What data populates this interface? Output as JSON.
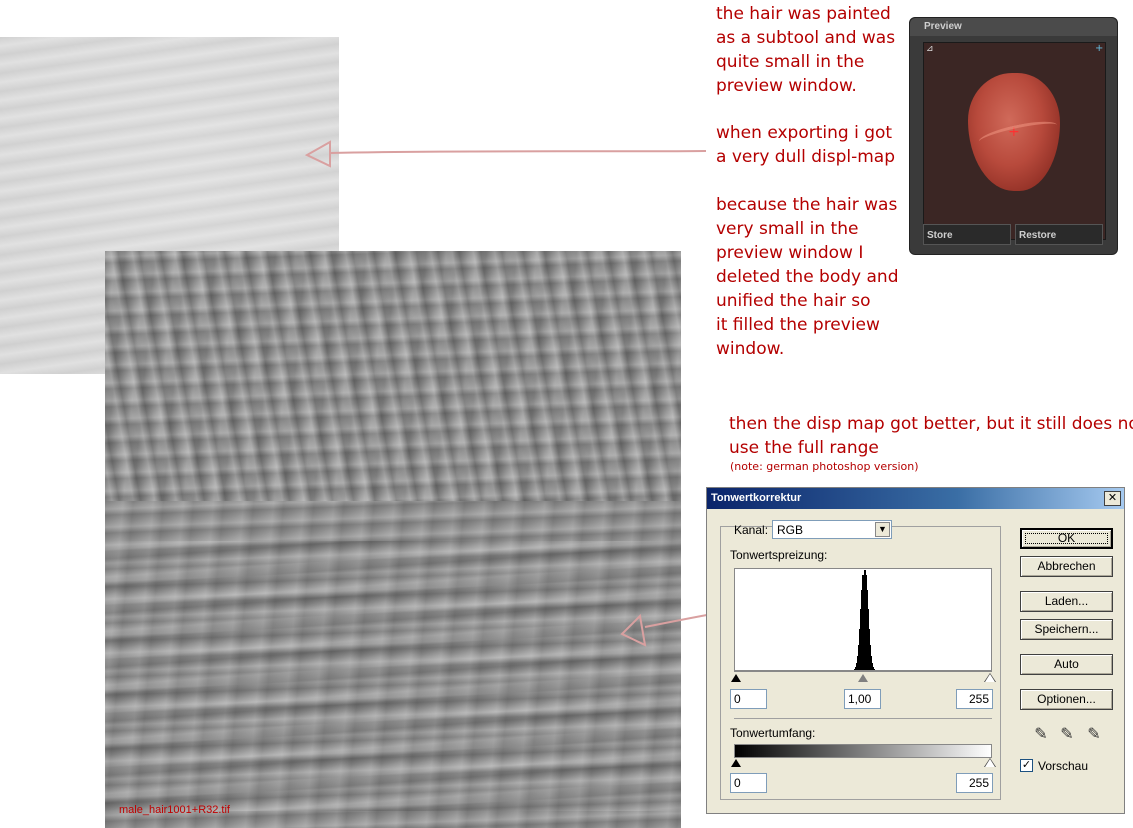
{
  "annotations": {
    "note1": "the hair was painted\nas a subtool and was\nquite small in the\npreview window.",
    "note2": "when exporting i got\na very dull displ-map",
    "note3": "because the hair was\nvery small in the\npreview window I\ndeleted the body and\nunified the hair so\nit filled the preview\nwindow.",
    "note4": "then the disp map got better, but it still does not\nuse the full range",
    "note5": "(note: german photoshop version)"
  },
  "texture": {
    "caption": "male_hair1001+R32.tif"
  },
  "zbrush_preview": {
    "title": "Preview",
    "store_label": "Store",
    "restore_label": "Restore",
    "model_color": "#b84a3c"
  },
  "levels_dialog": {
    "title": "Tonwertkorrektur",
    "close_glyph": "✕",
    "channel_label": "Kanal:",
    "channel_value": "RGB",
    "input_levels_label": "Tonwertspreizung:",
    "input_black": "0",
    "input_gamma": "1,00",
    "input_white": "255",
    "output_levels_label": "Tonwertumfang:",
    "output_black": "0",
    "output_white": "255",
    "buttons": {
      "ok": "OK",
      "cancel": "Abbrechen",
      "load": "Laden...",
      "save": "Speichern...",
      "auto": "Auto",
      "options": "Optionen..."
    },
    "preview_label": "Vorschau",
    "preview_checked": true,
    "histogram_range": [
      0,
      255
    ],
    "histogram_peak_at": 128
  },
  "colors": {
    "annotation_red": "#b40000",
    "dialog_titlebar": "#0a246a"
  }
}
